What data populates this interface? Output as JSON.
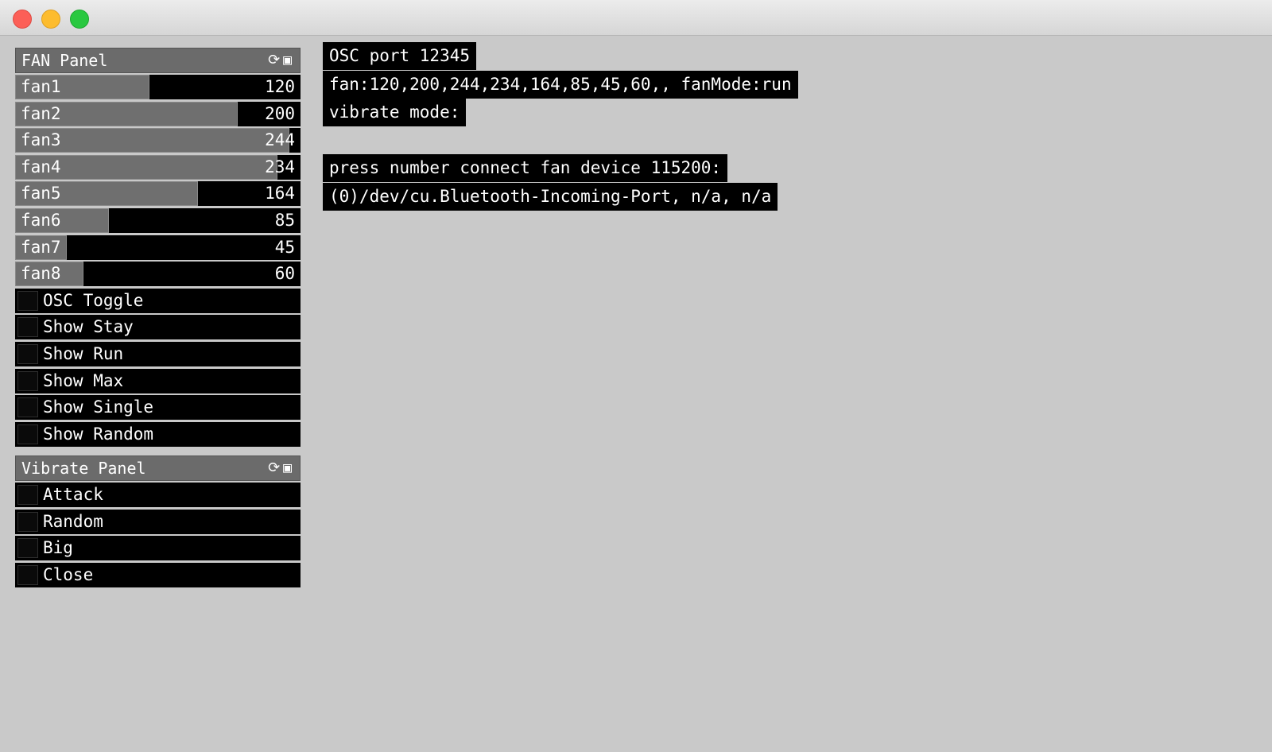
{
  "fan_panel": {
    "title": "FAN Panel",
    "header_icons": "⟳▣",
    "sliders": [
      {
        "label": "fan1",
        "value": "120",
        "level": 0.47
      },
      {
        "label": "fan2",
        "value": "200",
        "level": 0.78
      },
      {
        "label": "fan3",
        "value": "244",
        "level": 0.96
      },
      {
        "label": "fan4",
        "value": "234",
        "level": 0.92
      },
      {
        "label": "fan5",
        "value": "164",
        "level": 0.64
      },
      {
        "label": "fan6",
        "value": "85",
        "level": 0.33
      },
      {
        "label": "fan7",
        "value": "45",
        "level": 0.18
      },
      {
        "label": "fan8",
        "value": "60",
        "level": 0.24
      }
    ],
    "toggles": [
      {
        "label": "OSC Toggle"
      },
      {
        "label": "Show Stay"
      },
      {
        "label": "Show Run"
      },
      {
        "label": "Show Max"
      },
      {
        "label": "Show Single"
      },
      {
        "label": "Show Random"
      }
    ]
  },
  "vibrate_panel": {
    "title": "Vibrate Panel",
    "header_icons": "⟳▣",
    "toggles": [
      {
        "label": "Attack"
      },
      {
        "label": "Random"
      },
      {
        "label": "Big"
      },
      {
        "label": "Close"
      }
    ]
  },
  "console": {
    "osc_port": "OSC port 12345",
    "fan_status": "fan:120,200,244,234,164,85,45,60,, fanMode:run",
    "vibrate_mode": "vibrate mode:",
    "prompt": "press number connect fan device 115200:",
    "device": "(0)/dev/cu.Bluetooth-Incoming-Port, n/a, n/a"
  }
}
